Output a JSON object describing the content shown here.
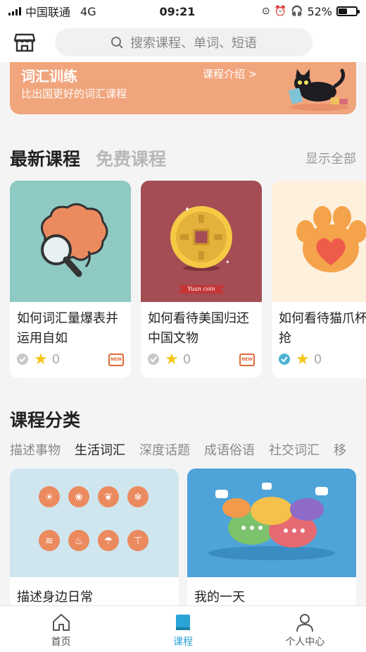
{
  "status_bar": {
    "carrier": "中国联通",
    "network": "4G",
    "time": "09:21",
    "battery": "52%",
    "battery_level": 0.52
  },
  "header": {
    "search_placeholder": "搜索课程、单词、短语",
    "icons": [
      "store-icon",
      "search-icon"
    ]
  },
  "banner": {
    "title": "词汇训练",
    "subtitle": "比出国更好的词汇课程",
    "link": "课程介绍 >",
    "color": "#f1a57c"
  },
  "courses_section": {
    "tabs": [
      "最新课程",
      "免费课程"
    ],
    "active_tab": "最新课程",
    "show_all": "显示全部",
    "cards": [
      {
        "title": "如何词汇量爆表并运用自如",
        "rating": "0",
        "badge": "NEW",
        "image_bg": "#8fc9c3"
      },
      {
        "title": "如何看待美国归还中国文物",
        "rating": "0",
        "badge": "NEW",
        "image_bg": "#a44d55",
        "image_text": "Yuan coin"
      },
      {
        "title": "如何看待猫爪杯哄抢",
        "rating": "0",
        "image_bg": "#fdf0dc"
      }
    ]
  },
  "category_section": {
    "title": "课程分类",
    "tabs": [
      "描述事物",
      "生活词汇",
      "深度话题",
      "成语俗语",
      "社交词汇",
      "移"
    ],
    "active_tab": "生活词汇",
    "cards": [
      {
        "title": "描述身边日常",
        "image_bg": "#cfe6ee"
      },
      {
        "title": "我的一天",
        "image_bg": "#4ea3d9"
      }
    ]
  },
  "tabbar": {
    "items": [
      {
        "label": "首页",
        "icon": "home-icon"
      },
      {
        "label": "课程",
        "icon": "book-icon"
      },
      {
        "label": "个人中心",
        "icon": "user-icon"
      }
    ],
    "active": "课程",
    "accent": "#2aa4d6"
  }
}
